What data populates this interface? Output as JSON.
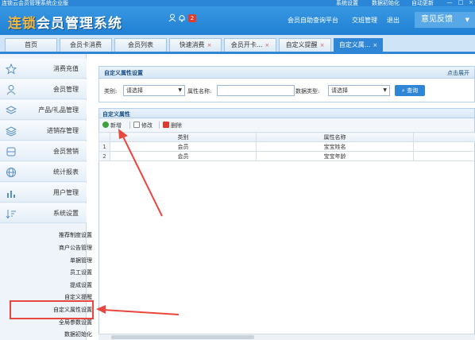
{
  "window": {
    "title": "连锁云会员管理系统企业版",
    "system_links": [
      "系统设置",
      "数据初始化",
      "自动更新"
    ],
    "min": "—",
    "max": "□",
    "close": "×"
  },
  "header": {
    "logo_brand": "连锁",
    "logo_rest": "会员管理系统",
    "notice_count": "2",
    "links": [
      "会员自助查询平台",
      "交班管理",
      "退出"
    ],
    "feedback_label": "意见反馈",
    "feedback_caret": "▼"
  },
  "tabs": [
    {
      "label": "首页",
      "closable": false
    },
    {
      "label": "会员卡消费",
      "closable": false
    },
    {
      "label": "会员列表",
      "closable": false
    },
    {
      "label": "快速消费",
      "closable": true
    },
    {
      "label": "会员开卡...",
      "closable": true
    },
    {
      "label": "自定义提醒",
      "closable": true
    },
    {
      "label": "自定义属...",
      "closable": true,
      "active": true
    }
  ],
  "tab_close": "×",
  "sidebar": {
    "items": [
      {
        "label": "消费充值",
        "icon": "star-icon"
      },
      {
        "label": "会员管理",
        "icon": "user-icon"
      },
      {
        "label": "产品/礼品管理",
        "icon": "layers-icon"
      },
      {
        "label": "进销存管理",
        "icon": "stack-icon"
      },
      {
        "label": "会员营销",
        "icon": "database-icon"
      },
      {
        "label": "统计报表",
        "icon": "globe-icon"
      },
      {
        "label": "用户管理",
        "icon": "bar-chart-icon"
      },
      {
        "label": "系统设置",
        "icon": "sort-icon"
      }
    ],
    "sub_items": [
      "推荐制度设置",
      "商户公告管理",
      "单据管理",
      "员工设置",
      "提成设置",
      "自定义提醒",
      "自定义属性设置",
      "全局参数设置",
      "数据初始化"
    ],
    "active_sub": "自定义属性设置"
  },
  "panel": {
    "title": "自定义属性设置",
    "expand_label": "点击展开",
    "filter": {
      "category_label": "类别:",
      "category_value": "请选择",
      "name_label": "属性名称:",
      "name_value": "",
      "type_label": "数据类型:",
      "type_value": "请选择",
      "query_label": "查询"
    }
  },
  "grid": {
    "title": "自定义属性",
    "toolbar": {
      "add": "新增",
      "edit": "修改",
      "delete": "删除"
    },
    "columns": [
      "",
      "类别",
      "属性名称",
      ""
    ],
    "rows": [
      {
        "num": "1",
        "category": "会员",
        "name": "宝宝姓名"
      },
      {
        "num": "2",
        "category": "会员",
        "name": "宝宝年龄"
      }
    ]
  },
  "colors": {
    "accent": "#2f86d6",
    "annotation": "#e8463e",
    "brand": "#f6b73c"
  }
}
